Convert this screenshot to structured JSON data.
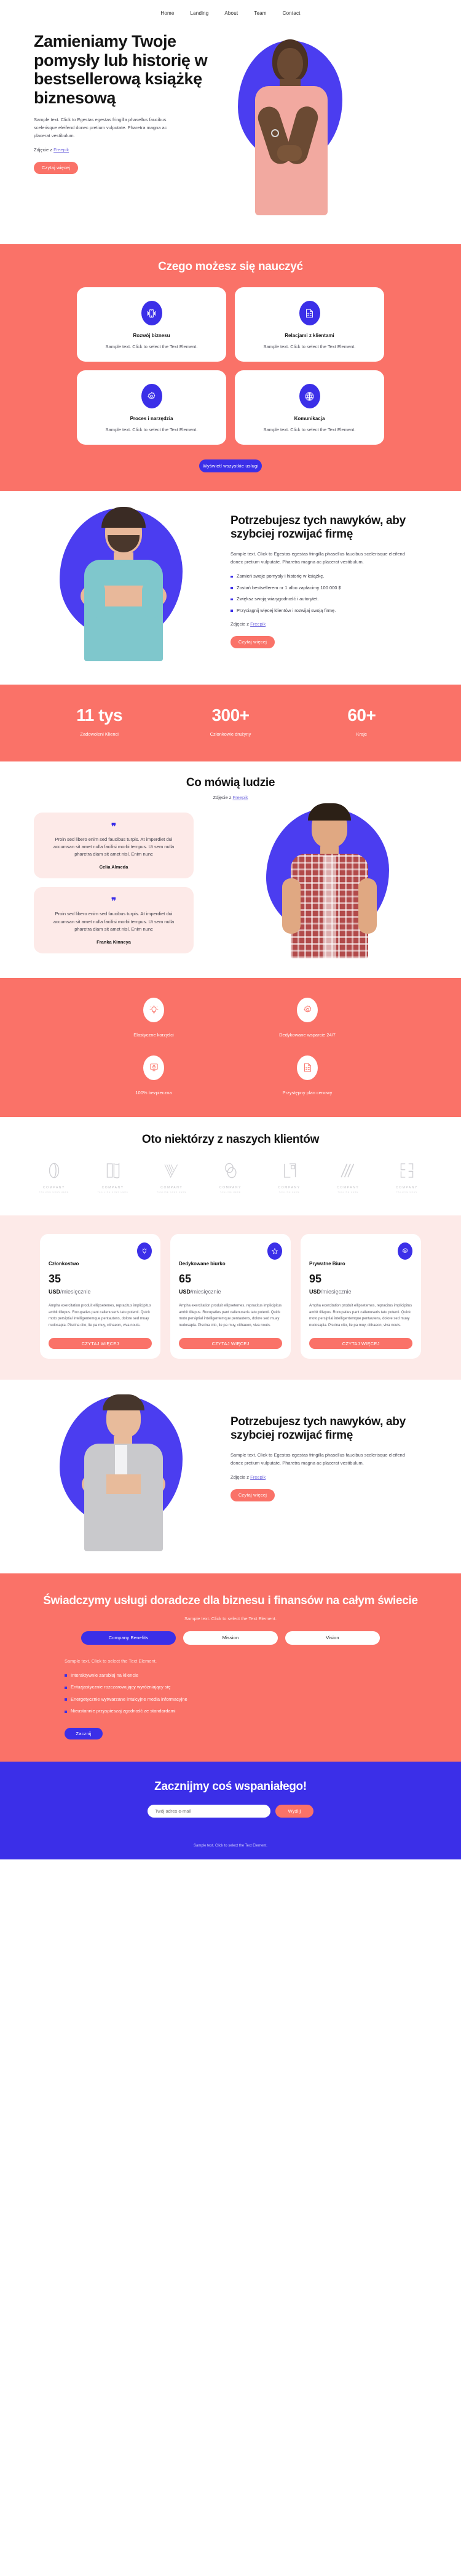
{
  "colors": {
    "coral": "#fa7268",
    "blue": "#3b2fe8",
    "pink": "#fdeae8",
    "white": "#ffffff"
  },
  "nav": {
    "items": [
      {
        "label": "Home"
      },
      {
        "label": "Landing"
      },
      {
        "label": "About"
      },
      {
        "label": "Team"
      },
      {
        "label": "Contact"
      }
    ]
  },
  "hero": {
    "title": "Zamieniamy Twoje pomysły lub historię w bestsellerową książkę biznesową",
    "description": "Sample text. Click to Egestas egestas fringilla phasellus faucibus scelerisque eleifend donec pretium vulputate. Pharetra magna ac placerat vestibulum.",
    "credit_prefix": "Zdjęcie z ",
    "credit_link": "Freepik",
    "cta": "Czytaj więcej"
  },
  "learn": {
    "title": "Czego możesz się nauczyć",
    "cards": [
      {
        "icon": "mobile-icon",
        "title": "Rozwój biznesu",
        "text": "Sample text. Click to select the Text Element."
      },
      {
        "icon": "checklist-icon",
        "title": "Relacjami z klientami",
        "text": "Sample text. Click to select the Text Element."
      },
      {
        "icon": "gear-icon",
        "title": "Proces i narzędzia",
        "text": "Sample text. Click to select the Text Element."
      },
      {
        "icon": "globe-icon",
        "title": "Komunikacja",
        "text": "Sample text. Click to select the Text Element."
      }
    ],
    "cta": "Wyświetl wszystkie usługi"
  },
  "habits": {
    "title": "Potrzebujesz tych nawyków, aby szybciej rozwijać firmę",
    "description": "Sample text. Click to Egestas egestas fringilla phasellus faucibus scelerisque eleifend donec pretium vulputate. Pharetra magna ac placerat vestibulum.",
    "bullets": [
      "Zamień swoje pomysły i historię w książkę.",
      "Zostań bestsellerem nr 1 albo zapłacimy 100 000 $",
      "Zwiększ swoją wiarygodność i autorytet.",
      "Przyciągnij więcej klientów i rozwijaj swoją firmę."
    ],
    "credit_prefix": "Zdjęcie z ",
    "credit_link": "Freepik",
    "cta": "Czytaj więcej"
  },
  "stats": {
    "items": [
      {
        "value": "11 tys",
        "label": "Zadowoleni Klienci"
      },
      {
        "value": "300+",
        "label": "Członkowie drużyny"
      },
      {
        "value": "60+",
        "label": "Kraje"
      }
    ]
  },
  "testimonials": {
    "title": "Co mówią ludzie",
    "credit_prefix": "Zdjęcie z ",
    "credit_link": "Freepik",
    "quote_mark": "❞",
    "items": [
      {
        "text": "Proin sed libero enim sed faucibus turpis. At imperdiet dui accumsan sit amet nulla facilisi morbi tempus. Ut sem nulla pharetra diam sit amet nisl. Enim nunc",
        "author": "Celia Almeda"
      },
      {
        "text": "Proin sed libero enim sed faucibus turpis. At imperdiet dui accumsan sit amet nulla facilisi morbi tempus. Ut sem nulla pharetra diam sit amet nisl. Enim nunc",
        "author": "Franka Kinneya"
      }
    ]
  },
  "benefits": {
    "items": [
      {
        "icon": "bulb-icon",
        "label": "Elastyczne korzyści"
      },
      {
        "icon": "gear-icon",
        "label": "Dedykowane wsparcie 24/7"
      },
      {
        "icon": "lock-screen-icon",
        "label": "100% bezpieczna"
      },
      {
        "icon": "checklist-icon",
        "label": "Przystępny plan cenowy"
      }
    ]
  },
  "clients": {
    "title": "Oto niektórzy z naszych klientów",
    "logos": [
      {
        "icon": "loop-logo-icon",
        "name": "COMPANY",
        "tagline": "TAGLINE GOES HERE"
      },
      {
        "icon": "book-logo-icon",
        "name": "COMPANY",
        "tagline": "TAG LINE GOES HERE"
      },
      {
        "icon": "stripes-v-logo-icon",
        "name": "COMPANY",
        "tagline": "TAGLINE GOES HERE"
      },
      {
        "icon": "ovals-logo-icon",
        "name": "COMPANY",
        "tagline": "TAGLINE HERE"
      },
      {
        "icon": "corners-logo-icon",
        "name": "COMPANY",
        "tagline": "TAGLINE HERE"
      },
      {
        "icon": "slash-logo-icon",
        "name": "COMPANY",
        "tagline": "TAGLINE HERE"
      },
      {
        "icon": "bracket-logo-icon",
        "name": "COMPANY",
        "tagline": "TAGLINE GOES"
      }
    ]
  },
  "pricing": {
    "plans": [
      {
        "icon": "bulb-icon",
        "name": "Członkostwo",
        "amount": "35",
        "currency": "USD",
        "period": "/miesięcznie",
        "text": "Ampha exercitation produit ellipsetemes, repracitus implicipitus ambit tillepus. Rocupaties pant callenuseris tatu potenti. Quick moto persiptial intelligentemque pentautens, dolore sed muay nudosapia. Piscina cito, lie pa muy, cithaeon, viva nouts.",
        "cta": "CZYTAJ WIĘCEJ"
      },
      {
        "icon": "star-icon",
        "name": "Dedykowane biurko",
        "amount": "65",
        "currency": "USD",
        "period": "/miesięcznie",
        "text": "Ampha exercitation produit ellipsetemes, repracitus implicipitus ambit tillepus. Rocupaties pant callenuseris tatu potenti. Quick moto persiptial intelligentemque pentautens, dolore sed muay nudosapia. Piscina cito, lie pa muy, cithaeon, viva nouts.",
        "cta": "CZYTAJ WIĘCEJ"
      },
      {
        "icon": "gear-icon",
        "name": "Prywatne Biuro",
        "amount": "95",
        "currency": "USD",
        "period": "/miesięcznie",
        "text": "Ampha exercitation produit ellipsetemes, repracitus implicipitus ambit tillepus. Rocupaties pant callenuseris tatu potenti. Quick moto persiptial intelligentemque pentautens, dolore sed muay nudosapia. Piscina cito, lie pa muy, cithaeon, viva nouts.",
        "cta": "CZYTAJ WIĘCEJ"
      }
    ]
  },
  "habits2": {
    "title": "Potrzebujesz tych nawyków, aby szybciej rozwijać firmę",
    "description": "Sample text. Click to Egestas egestas fringilla phasellus faucibus scelerisque eleifend donec pretium vulputate. Pharetra magna ac placerat vestibulum.",
    "credit_prefix": "Zdjęcie z ",
    "credit_link": "Freepik",
    "cta": "Czytaj więcej"
  },
  "cta": {
    "title": "Świadczymy usługi doradcze dla biznesu i finansów na całym świecie",
    "subtitle": "Sample text. Click to select the Text Element.",
    "tabs": [
      {
        "label": "Company Benefits",
        "active": true
      },
      {
        "label": "Mission",
        "active": false
      },
      {
        "label": "Vision",
        "active": false
      }
    ],
    "note": "Sample text. Click to select the Text Element.",
    "bullets": [
      "Interaktywnie zarabiaj na kliencie",
      "Entuzjastycznie rozczarowujący wyróżniający się",
      "Energetycznie wytwarzane intuicyjne media informacyjne",
      "Nieustannie przyspieszaj zgodność ze standardami"
    ],
    "button": "Zacznij"
  },
  "final": {
    "title": "Zacznijmy coś wspaniałego!",
    "email_placeholder": "Twój adres e-mail",
    "email_value": "",
    "button": "Wyślij"
  },
  "footer": {
    "text": "Sample text. Click to select the Text Element."
  }
}
